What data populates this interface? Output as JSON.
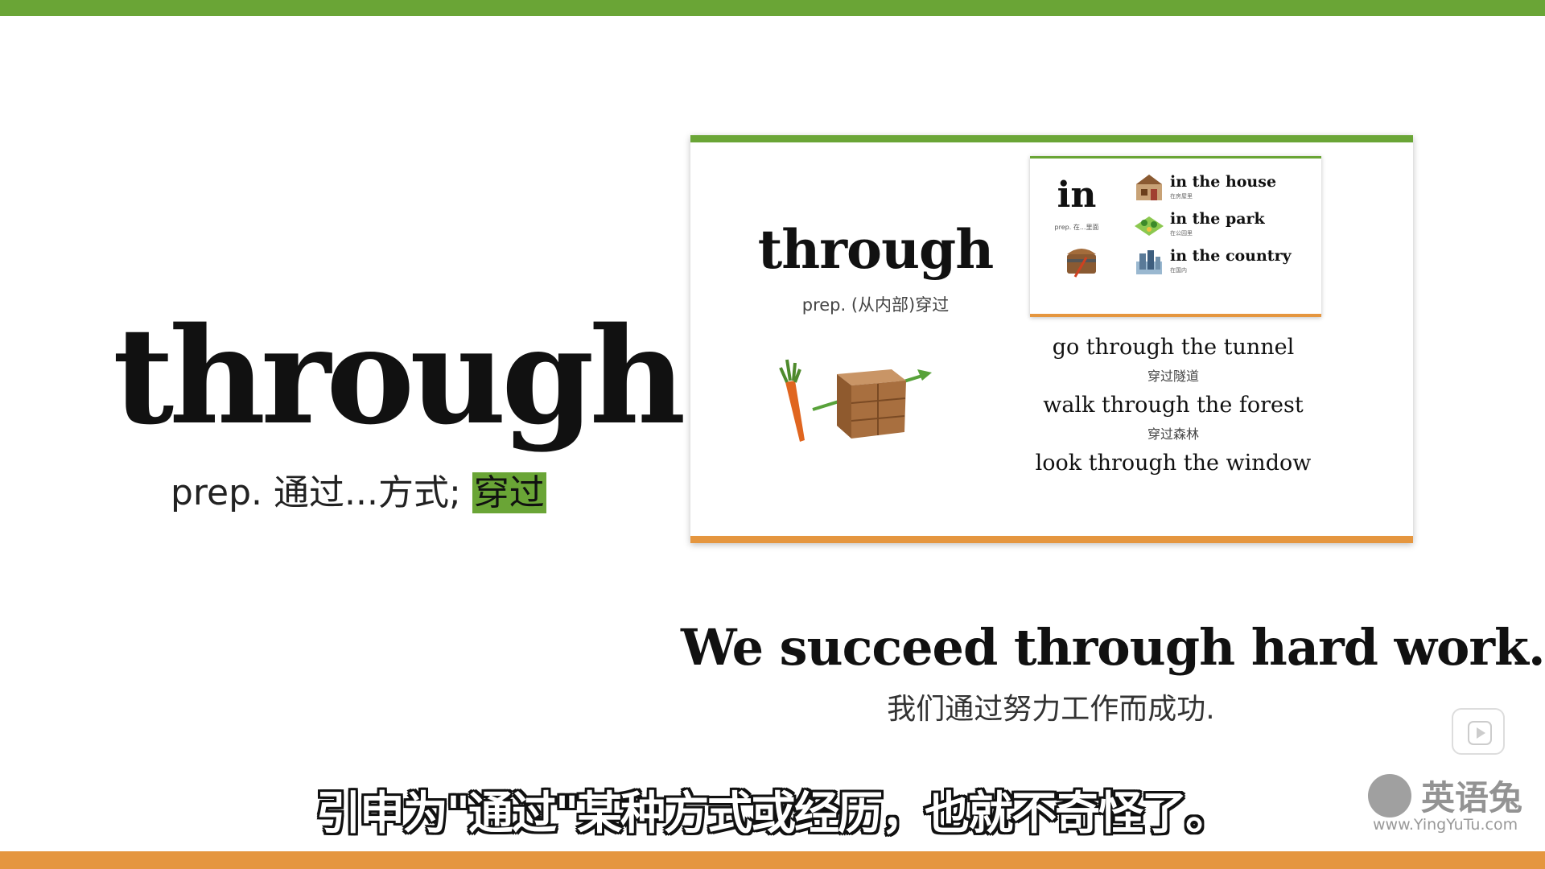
{
  "main": {
    "word": "through",
    "definition_prefix": "prep. 通过...方式; ",
    "definition_highlight": "穿过"
  },
  "card": {
    "word": "through",
    "definition": "prep. (从内部)穿过",
    "inset": {
      "word": "in",
      "definition": "prep. 在...里面",
      "items": [
        {
          "en": "in the house",
          "zh": "在房屋里",
          "icon": "house-icon"
        },
        {
          "en": "in the park",
          "zh": "在公园里",
          "icon": "park-icon"
        },
        {
          "en": "in the country",
          "zh": "在国内",
          "icon": "country-icon"
        }
      ]
    },
    "examples": [
      {
        "en": "go through the tunnel",
        "zh": "穿过隧道"
      },
      {
        "en": "walk through the forest",
        "zh": "穿过森林"
      },
      {
        "en": "look through the window",
        "zh": ""
      }
    ]
  },
  "sentence": {
    "en": "We succeed through hard work.",
    "zh": "我们通过努力工作而成功."
  },
  "subtitle": "引申为\"通过\"某种方式或经历，也就不奇怪了。",
  "watermark": {
    "name": "英语兔",
    "url": "www.YingYuTu.com"
  },
  "colors": {
    "green": "#6aa536",
    "orange": "#e5963f"
  }
}
